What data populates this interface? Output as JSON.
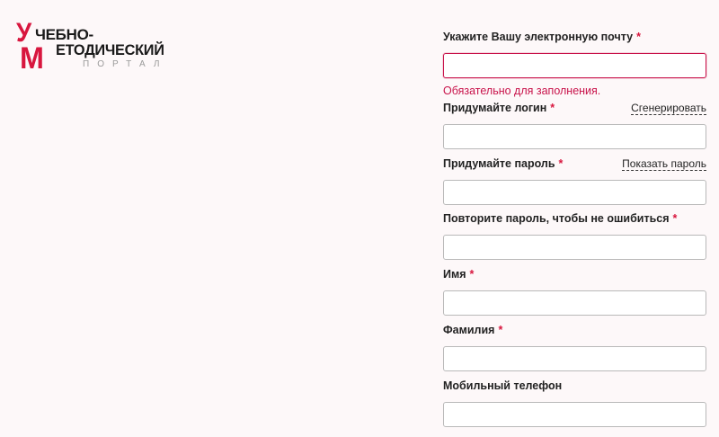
{
  "logo": {
    "letter_u": "У",
    "line1": "ЧЕБНО-",
    "letter_m": "М",
    "line2": "ЕТОДИЧЕСКИЙ",
    "line3": "ПОРТАЛ"
  },
  "form": {
    "required_mark": "*",
    "email": {
      "label": "Укажите Вашу электронную почту",
      "value": "",
      "error": "Обязательно для заполнения."
    },
    "login": {
      "label": "Придумайте логин",
      "link": "Сгенерировать",
      "value": ""
    },
    "password": {
      "label": "Придумайте пароль",
      "link": "Показать пароль",
      "value": ""
    },
    "password_repeat": {
      "label": "Повторите пароль, чтобы не ошибиться",
      "value": ""
    },
    "first_name": {
      "label": "Имя",
      "value": ""
    },
    "last_name": {
      "label": "Фамилия",
      "value": ""
    },
    "phone": {
      "label": "Мобильный телефон",
      "value": ""
    }
  },
  "colors": {
    "accent": "#d8163e",
    "error": "#c8124a",
    "background": "#fdf8f9"
  }
}
